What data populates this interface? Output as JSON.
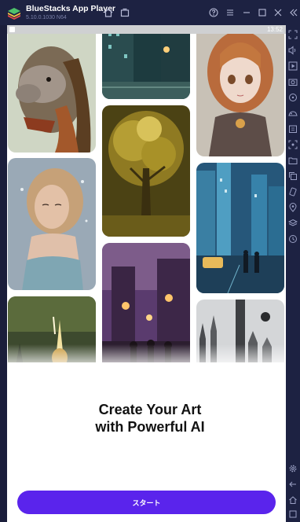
{
  "window": {
    "app_title": "BlueStacks App Player",
    "app_version": "5.10.0.1030 N64"
  },
  "status_bar": {
    "time": "13:52"
  },
  "onboarding": {
    "headline_line1": "Create Your Art",
    "headline_line2": "with Powerful AI",
    "start_button_label": "スタート"
  },
  "gallery": {
    "tiles": [
      "llama-portrait",
      "city-night-street",
      "anime-girl",
      "golden-tree",
      "woman-portrait",
      "rainy-city",
      "lantern-street",
      "golden-spire",
      "gothic-skyline"
    ]
  },
  "colors": {
    "accent": "#5a24ec",
    "chrome": "#1d2242"
  },
  "icons": {
    "titlebar": [
      "home-icon",
      "multi-instance-icon",
      "help-icon",
      "menu-icon",
      "minimize-icon",
      "maximize-icon",
      "close-icon",
      "collapse-sidebar-icon"
    ],
    "sidebar": [
      "fullscreen-icon",
      "volume-icon",
      "media-icon",
      "screenshot-icon",
      "macro-icon",
      "controls-icon",
      "apk-icon",
      "screen-capture-icon",
      "folder-icon",
      "copy-icon",
      "shake-icon",
      "location-icon",
      "layers-icon",
      "eco-icon",
      "settings-icon",
      "back-icon",
      "home-icon",
      "recents-icon"
    ]
  }
}
